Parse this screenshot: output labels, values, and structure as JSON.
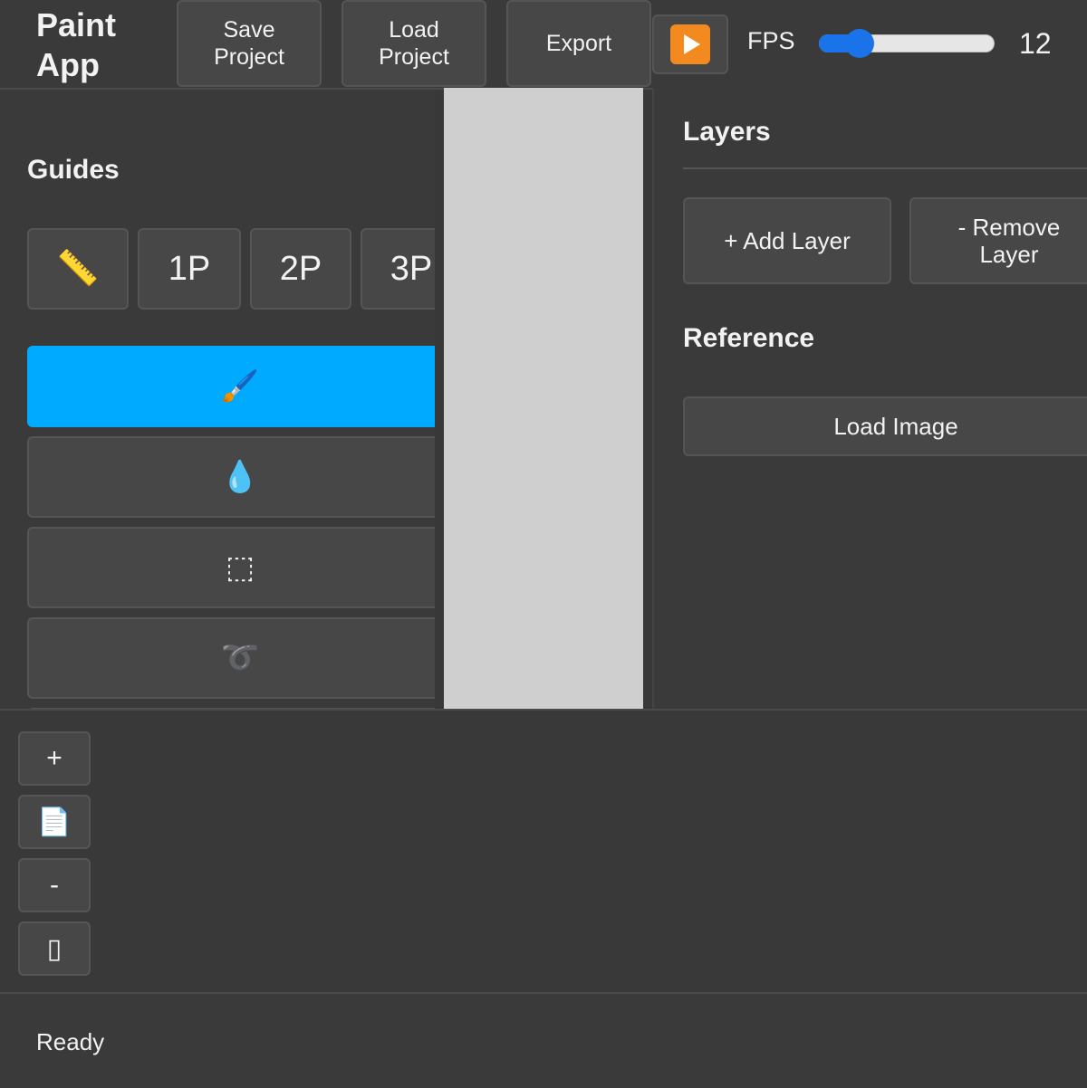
{
  "app": {
    "title": "Paint\nApp"
  },
  "toolbar": {
    "save_label": "Save\nProject",
    "load_label": "Load\nProject",
    "export_label": "Export",
    "play_icon": "play-button-icon",
    "fps_label": "FPS",
    "fps_value": "12",
    "fps_slider_fraction": 0.23
  },
  "guides": {
    "title": "Guides",
    "buttons": [
      {
        "label": "📏",
        "icon": "ruler-icon"
      },
      {
        "label": "1P"
      },
      {
        "label": "2P"
      },
      {
        "label": "3P"
      }
    ]
  },
  "tools": [
    {
      "icon": "brush-icon",
      "glyph": "🖌️",
      "active": true
    },
    {
      "icon": "droplet-icon",
      "glyph": "💧",
      "active": false
    },
    {
      "icon": "rectangle-select-icon",
      "glyph": "⬚",
      "active": false
    },
    {
      "icon": "lasso-icon",
      "glyph": "➰",
      "active": false
    }
  ],
  "layers": {
    "title": "Layers",
    "add_label": "+ Add Layer",
    "remove_label": "- Remove\nLayer"
  },
  "reference": {
    "title": "Reference",
    "load_label": "Load Image"
  },
  "frames": {
    "buttons": [
      {
        "label": "+",
        "icon": "add-frame-icon"
      },
      {
        "label": "📄",
        "icon": "document-icon"
      },
      {
        "label": "-",
        "icon": "remove-frame-icon"
      },
      {
        "label": "▯",
        "icon": "blank-frame-icon"
      }
    ]
  },
  "status": {
    "text": "Ready"
  },
  "colors": {
    "accent": "#00aaff",
    "slider": "#1a73e8",
    "play": "#f28a1f",
    "canvas": "#cfcfcf"
  }
}
